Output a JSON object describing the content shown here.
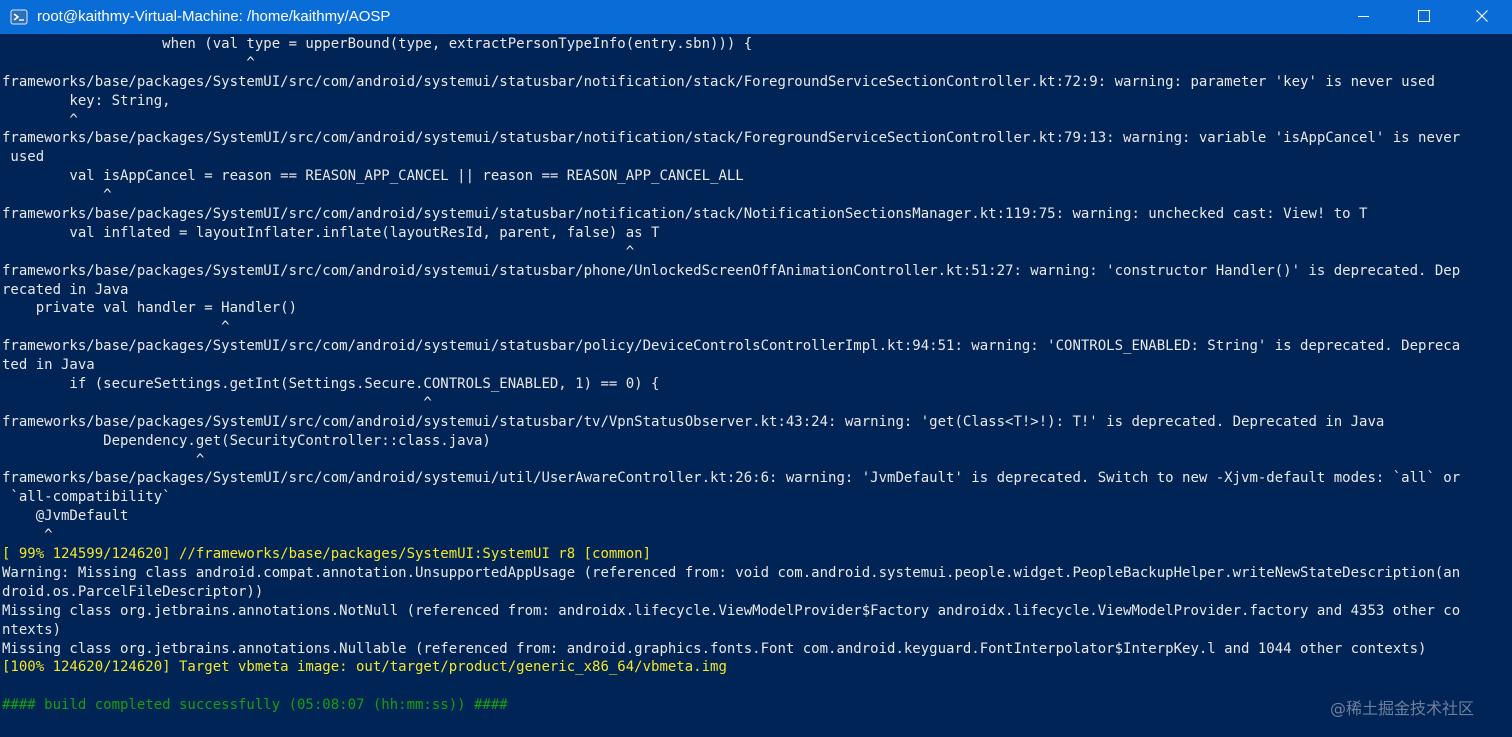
{
  "window": {
    "title": "root@kaithmy-Virtual-Machine: /home/kaithmy/AOSP",
    "icon": "powershell-icon",
    "buttons": {
      "minimize": "minimize-icon",
      "maximize": "maximize-icon",
      "close": "close-icon"
    }
  },
  "colors": {
    "titlebar": "#0a6cd6",
    "background": "#012456",
    "text": "#e8e8e8",
    "progress": "#f2e62a",
    "success": "#13a10e"
  },
  "terminal": {
    "lines": [
      {
        "text": "                   when (val type = upperBound(type, extractPersonTypeInfo(entry.sbn))) {",
        "style": "normal"
      },
      {
        "text": "                             ^",
        "style": "normal"
      },
      {
        "text": "frameworks/base/packages/SystemUI/src/com/android/systemui/statusbar/notification/stack/ForegroundServiceSectionController.kt:72:9: warning: parameter 'key' is never used",
        "style": "normal"
      },
      {
        "text": "        key: String,",
        "style": "normal"
      },
      {
        "text": "        ^",
        "style": "normal"
      },
      {
        "text": "frameworks/base/packages/SystemUI/src/com/android/systemui/statusbar/notification/stack/ForegroundServiceSectionController.kt:79:13: warning: variable 'isAppCancel' is never",
        "style": "normal"
      },
      {
        "text": " used",
        "style": "normal"
      },
      {
        "text": "        val isAppCancel = reason == REASON_APP_CANCEL || reason == REASON_APP_CANCEL_ALL",
        "style": "normal"
      },
      {
        "text": "            ^",
        "style": "normal"
      },
      {
        "text": "frameworks/base/packages/SystemUI/src/com/android/systemui/statusbar/notification/stack/NotificationSectionsManager.kt:119:75: warning: unchecked cast: View! to T",
        "style": "normal"
      },
      {
        "text": "        val inflated = layoutInflater.inflate(layoutResId, parent, false) as T",
        "style": "normal"
      },
      {
        "text": "                                                                          ^",
        "style": "normal"
      },
      {
        "text": "frameworks/base/packages/SystemUI/src/com/android/systemui/statusbar/phone/UnlockedScreenOffAnimationController.kt:51:27: warning: 'constructor Handler()' is deprecated. Dep",
        "style": "normal"
      },
      {
        "text": "recated in Java",
        "style": "normal"
      },
      {
        "text": "    private val handler = Handler()",
        "style": "normal"
      },
      {
        "text": "                          ^",
        "style": "normal"
      },
      {
        "text": "frameworks/base/packages/SystemUI/src/com/android/systemui/statusbar/policy/DeviceControlsControllerImpl.kt:94:51: warning: 'CONTROLS_ENABLED: String' is deprecated. Depreca",
        "style": "normal"
      },
      {
        "text": "ted in Java",
        "style": "normal"
      },
      {
        "text": "        if (secureSettings.getInt(Settings.Secure.CONTROLS_ENABLED, 1) == 0) {",
        "style": "normal"
      },
      {
        "text": "                                                  ^",
        "style": "normal"
      },
      {
        "text": "frameworks/base/packages/SystemUI/src/com/android/systemui/statusbar/tv/VpnStatusObserver.kt:43:24: warning: 'get(Class<T!>!): T!' is deprecated. Deprecated in Java",
        "style": "normal"
      },
      {
        "text": "            Dependency.get(SecurityController::class.java)",
        "style": "normal"
      },
      {
        "text": "                       ^",
        "style": "normal"
      },
      {
        "text": "frameworks/base/packages/SystemUI/src/com/android/systemui/util/UserAwareController.kt:26:6: warning: 'JvmDefault' is deprecated. Switch to new -Xjvm-default modes: `all` or",
        "style": "normal"
      },
      {
        "text": " `all-compatibility`",
        "style": "normal"
      },
      {
        "text": "    @JvmDefault",
        "style": "normal"
      },
      {
        "text": "     ^",
        "style": "normal"
      },
      {
        "text": "[ 99% 124599/124620] //frameworks/base/packages/SystemUI:SystemUI r8 [common]",
        "style": "yellow"
      },
      {
        "text": "Warning: Missing class android.compat.annotation.UnsupportedAppUsage (referenced from: void com.android.systemui.people.widget.PeopleBackupHelper.writeNewStateDescription(an",
        "style": "normal"
      },
      {
        "text": "droid.os.ParcelFileDescriptor))",
        "style": "normal"
      },
      {
        "text": "Missing class org.jetbrains.annotations.NotNull (referenced from: androidx.lifecycle.ViewModelProvider$Factory androidx.lifecycle.ViewModelProvider.factory and 4353 other co",
        "style": "normal"
      },
      {
        "text": "ntexts)",
        "style": "normal"
      },
      {
        "text": "Missing class org.jetbrains.annotations.Nullable (referenced from: android.graphics.fonts.Font com.android.keyguard.FontInterpolator$InterpKey.l and 1044 other contexts)",
        "style": "normal"
      },
      {
        "text": "[100% 124620/124620] Target vbmeta image: out/target/product/generic_x86_64/vbmeta.img",
        "style": "yellow"
      },
      {
        "text": "",
        "style": "normal"
      },
      {
        "text": "#### build completed successfully (05:08:07 (hh:mm:ss)) ####",
        "style": "green"
      }
    ]
  },
  "watermark": "@稀土掘金技术社区"
}
